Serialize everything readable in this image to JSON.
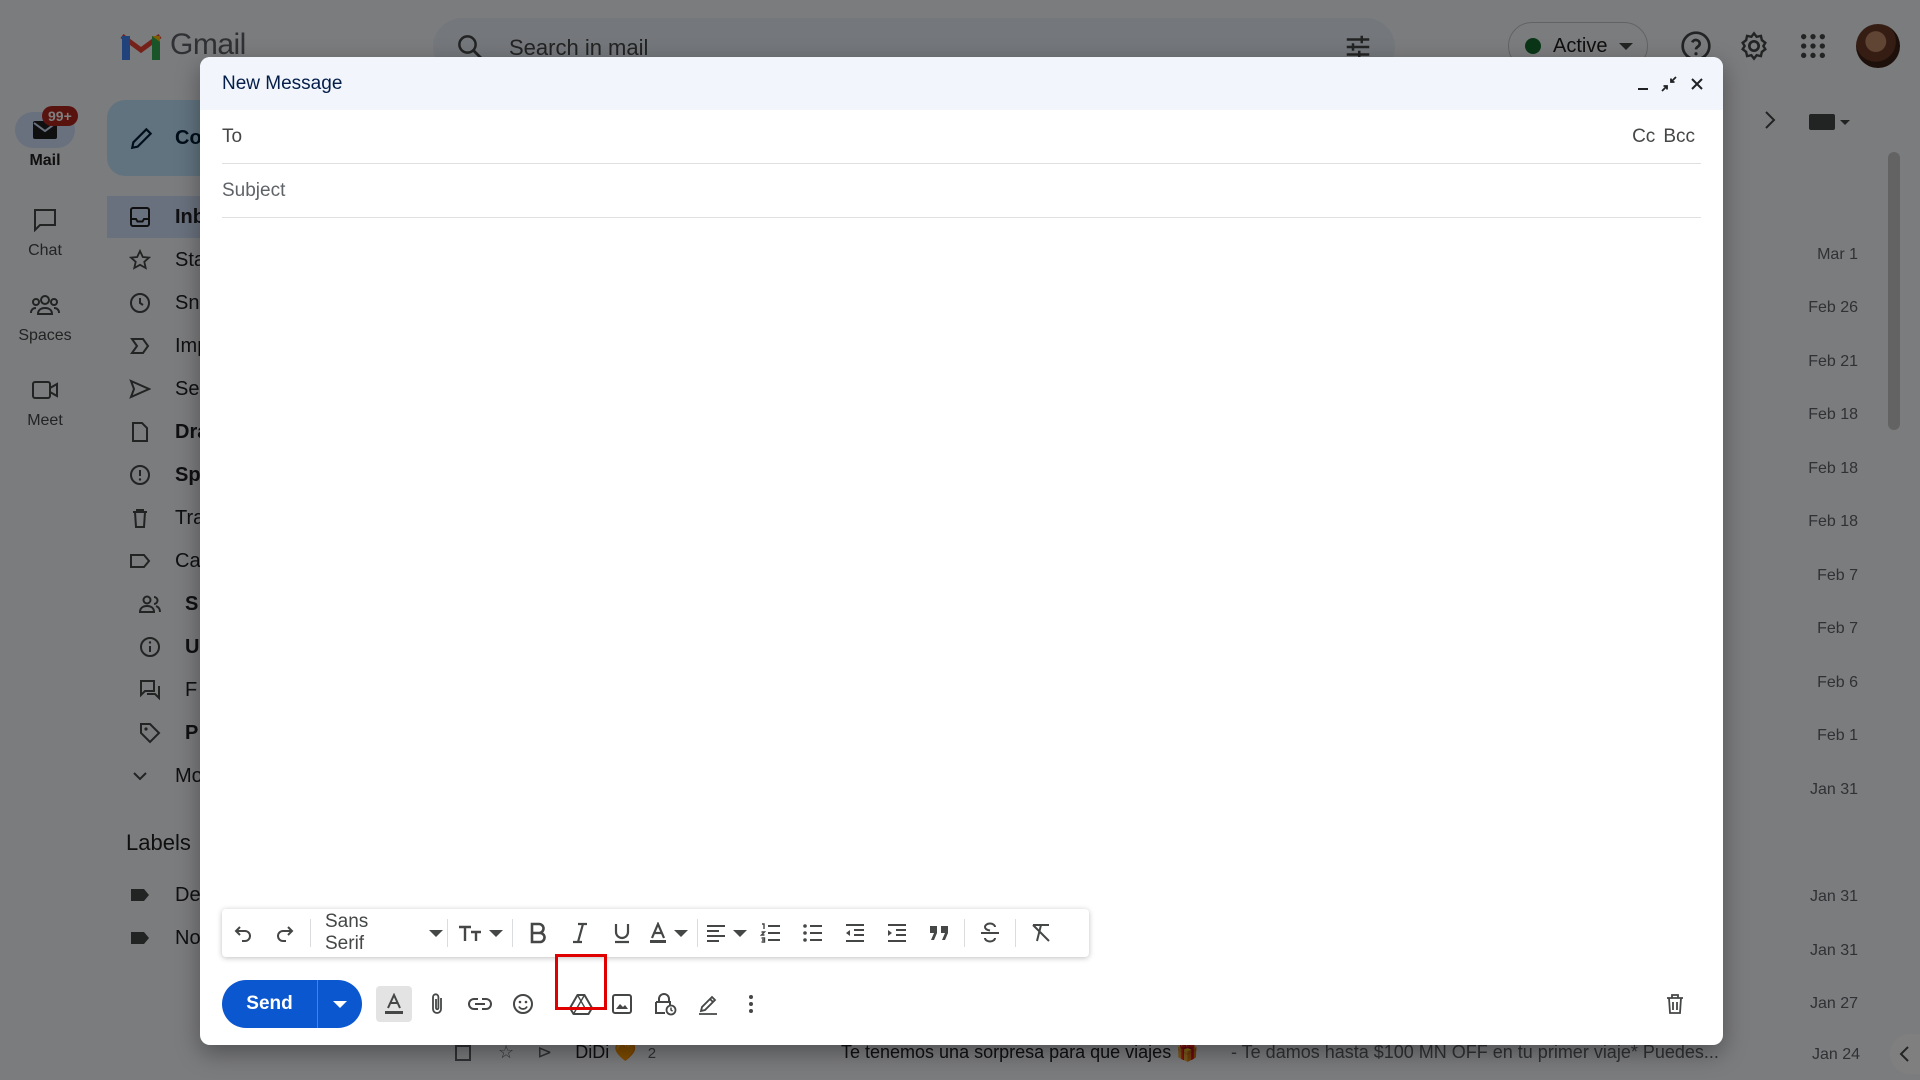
{
  "app": {
    "logo_text": "Gmail",
    "search_placeholder": "Search in mail",
    "status_label": "Active"
  },
  "rail": [
    {
      "label": "Mail",
      "badge": "99+"
    },
    {
      "label": "Chat"
    },
    {
      "label": "Spaces"
    },
    {
      "label": "Meet"
    }
  ],
  "sidebar": {
    "compose_label": "Co",
    "items": [
      {
        "label": "Inb"
      },
      {
        "label": "Sta"
      },
      {
        "label": "Sn"
      },
      {
        "label": "Imp"
      },
      {
        "label": "Se"
      },
      {
        "label": "Dra"
      },
      {
        "label": "Sp"
      },
      {
        "label": "Tra"
      },
      {
        "label": "Ca"
      },
      {
        "label": "S"
      },
      {
        "label": "U"
      },
      {
        "label": "F"
      },
      {
        "label": "P"
      },
      {
        "label": "Mo"
      }
    ],
    "labels_heading": "Labels",
    "labels": [
      {
        "label": "De"
      },
      {
        "label": "No"
      }
    ]
  },
  "mail_dates": [
    "Mar 1",
    "Feb 26",
    "Feb 21",
    "Feb 18",
    "Feb 18",
    "Feb 18",
    "Feb 7",
    "Feb 7",
    "Feb 6",
    "Feb 1",
    "Jan 31",
    "Jan 31",
    "Jan 31",
    "Jan 27"
  ],
  "bottom_row": {
    "sender": "DiDi 🧡",
    "count": "2",
    "subject": "Te tenemos una sorpresa para que viajes 🎁",
    "snippet": " - Te damos hasta $100 MN OFF en tu primer viaje* Puedes...",
    "date": "Jan 24"
  },
  "compose": {
    "title": "New Message",
    "to_label": "To",
    "cc_label": "Cc",
    "bcc_label": "Bcc",
    "subject_placeholder": "Subject",
    "font_name": "Sans Serif",
    "send_label": "Send"
  },
  "colors": {
    "send": "#0b57d0",
    "header": "#f2f6fc",
    "highlight": "#e00000",
    "status": "#146c2e"
  }
}
